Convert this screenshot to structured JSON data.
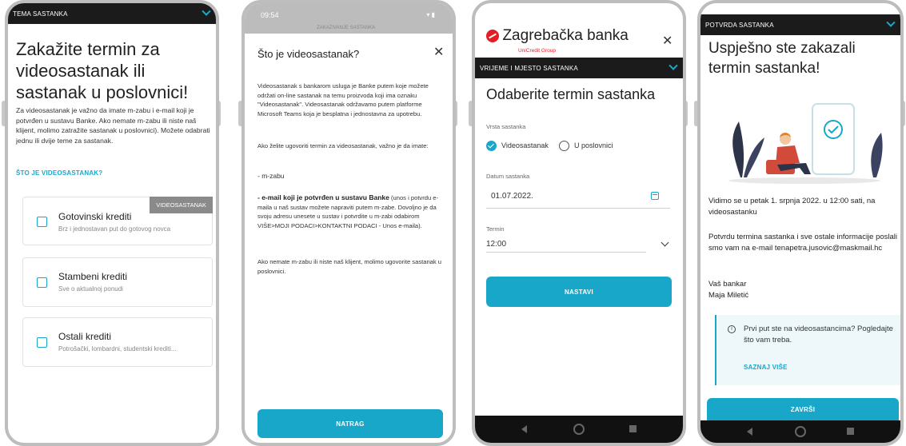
{
  "colors": {
    "accent": "#19a7c9",
    "dark_bar": "#1b1b1b",
    "brand_red": "#e31e24"
  },
  "screen1": {
    "section": "TEMA SASTANKA",
    "title": "Zakažite termin za videosastanak ili sastanak u poslovnici!",
    "paragraph": "Za videosastanak je važno da imate m-zabu i e-mail koji je potvrđen u sustavu Banke. Ako nemate m-zabu ili niste naš klijent, molimo zatražite sastanak u poslovnici). Možete odabrati jednu ili dvije teme za sastanak.",
    "link": "ŠTO JE VIDEOSASTANAK?",
    "tag": "VIDEOSASTANAK",
    "items": [
      {
        "title": "Gotovinski krediti",
        "subtitle": "Brz i jednostavan put do gotovog novca"
      },
      {
        "title": "Stambeni krediti",
        "subtitle": "Sve o aktualnoj ponudi"
      },
      {
        "title": "Ostali krediti",
        "subtitle": "Potrošački, lombardni, studentski krediti..."
      }
    ]
  },
  "screen2": {
    "status_time": "09:54",
    "behind_title": "ZAKAZIVANJE SASTANKA",
    "title": "Što je videosastanak?",
    "close": "✕",
    "p1": "Videosastanak s bankarom usluga je Banke putem koje možete održati on-line sastanak na temu proizvoda koji ima oznaku \"Videosastanak\". Videosastanak održavamo putem platforme Microsoft Teams koja je besplatna i jednostavna za upotrebu.",
    "p2": "Ako želite ugovoriti termin za videosastanak, važno je da imate:",
    "p3": "- m-zabu",
    "p4_bold": "- e-mail koji je potvrđen u sustavu Banke",
    "p4_rest": " (unos i potvrdu e-maila u naš sustav možete napraviti putem m-zabe. Dovoljno je da svoju adresu unesete u sustav i potvrdite u m-zabi odabirom VIŠE>MOJI PODACI>KONTAKTNI PODACI - Unos e-maila).",
    "p5": "Ako nemate m-zabu ili niste naš klijent, molimo ugovorite sastanak u poslovnici.",
    "button": "NATRAG"
  },
  "screen3": {
    "logo": "Zagrebačka banka",
    "logo_sub": "UniCredit Group",
    "close": "✕",
    "section": "VRIJEME I MJESTO SASTANKA",
    "title": "Odaberite termin sastanka",
    "type_label": "Vrsta sastanka",
    "option_video": "Videosastanak",
    "option_branch": "U poslovnici",
    "date_label": "Datum sastanka",
    "date_value": "01.07.2022.",
    "time_label": "Termin",
    "time_value": "12:00",
    "button": "NASTAVI"
  },
  "screen4": {
    "section": "POTVRDA SASTANKA",
    "title": "Uspješno ste zakazali termin sastanka!",
    "p1": "Vidimo se u petak 1. srpnja 2022. u 12:00 sati, na videosastanku",
    "p2": "Potvrdu termina sastanka i sve ostale informacije poslali smo vam na e-mail tenapetra.jusovic@maskmail.hc",
    "signoff": "Vaš bankar",
    "banker": "Maja Miletić",
    "info_text": "Prvi put ste na videosastancima? Pogledajte što vam treba.",
    "info_link": "SAZNAJ VIŠE",
    "button": "ZAVRŠI"
  }
}
